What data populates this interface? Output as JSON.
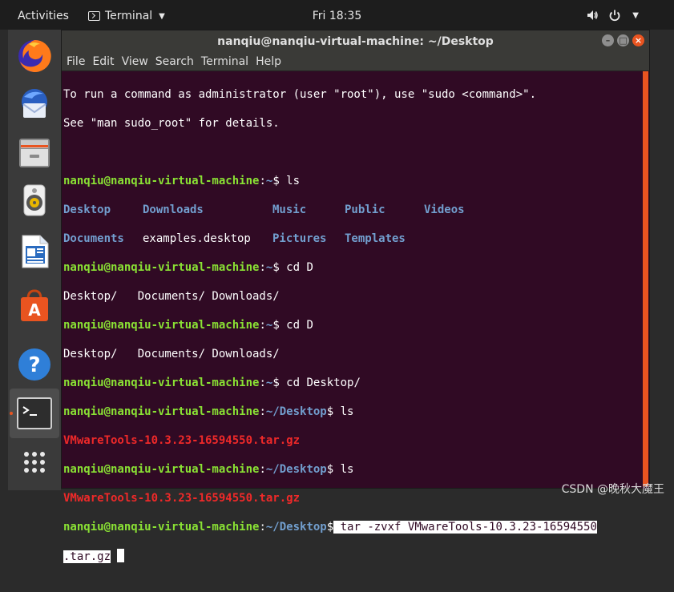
{
  "topbar": {
    "activities": "Activities",
    "app_name": "Terminal",
    "clock": "Fri 18:35"
  },
  "dock": {
    "items": [
      {
        "name": "firefox-icon"
      },
      {
        "name": "thunderbird-icon"
      },
      {
        "name": "files-icon"
      },
      {
        "name": "rhythmbox-icon"
      },
      {
        "name": "libreoffice-writer-icon"
      },
      {
        "name": "software-center-icon"
      },
      {
        "name": "help-icon"
      },
      {
        "name": "terminal-icon"
      },
      {
        "name": "show-apps-icon"
      }
    ]
  },
  "window": {
    "title": "nanqiu@nanqiu-virtual-machine: ~/Desktop",
    "menu": [
      "File",
      "Edit",
      "View",
      "Search",
      "Terminal",
      "Help"
    ]
  },
  "terminal": {
    "intro1": "To run a command as administrator (user \"root\"), use \"sudo <command>\".",
    "intro2": "See \"man sudo_root\" for details.",
    "user_host": "nanqiu@nanqiu-virtual-machine",
    "home_path": "~",
    "desktop_path": "~/Desktop",
    "cmd_ls": " ls",
    "cmd_cd_d": " cd D",
    "cmd_cd_desktop": " cd Desktop/",
    "ls_row1": [
      "Desktop",
      "Downloads",
      "Music",
      "Public",
      "Videos"
    ],
    "ls_row2_dir1": "Documents",
    "ls_row2_file": "examples.desktop",
    "ls_row2_dirs": [
      "Pictures",
      "Templates"
    ],
    "completion": "Desktop/   Documents/ Downloads/",
    "archive": "VMwareTools-10.3.23-16594550.tar.gz",
    "final_cmd_part1": " tar -zvxf VMwareTools-10.3.23-16594550",
    "final_cmd_part2": ".tar.gz"
  },
  "watermark": "CSDN @晚秋大魔王",
  "colors": {
    "terminal_bg": "#300a24",
    "accent": "#e95420",
    "prompt_user": "#8ae234",
    "prompt_path": "#729fcf",
    "archive": "#ef2929"
  }
}
